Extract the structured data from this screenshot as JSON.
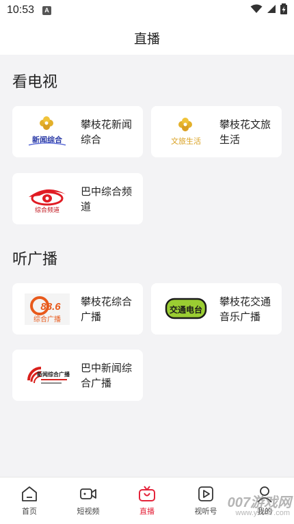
{
  "status_bar": {
    "time": "10:53",
    "indicator": "A",
    "icons": [
      "wifi-icon",
      "signal-icon",
      "battery-charging-icon"
    ]
  },
  "header": {
    "title": "直播"
  },
  "tv_section": {
    "title": "看电视",
    "channels": [
      {
        "name": "攀枝花新闻综合",
        "logo_text": "新闻综合",
        "logo_icon": "flower-emblem-icon"
      },
      {
        "name": "攀枝花文旅生活",
        "logo_text": "文旅生活",
        "logo_icon": "flower-emblem-icon"
      },
      {
        "name": "巴中综合频道",
        "logo_text": "综合频道",
        "logo_icon": "red-eye-logo-icon"
      }
    ]
  },
  "radio_section": {
    "title": "听广播",
    "channels": [
      {
        "name": "攀枝花综合广播",
        "logo_text": "综合广播",
        "logo_number": "88.6",
        "logo_icon": "radio-88-logo-icon"
      },
      {
        "name": "攀枝花交通音乐广播",
        "logo_text": "交通电台",
        "logo_icon": "traffic-radio-logo-icon"
      },
      {
        "name": "巴中新闻综合广播",
        "logo_text": "新闻综合广播",
        "logo_icon": "bazhong-radio-logo-icon"
      }
    ]
  },
  "bottom_nav": {
    "items": [
      {
        "label": "首页",
        "icon": "home-icon",
        "active": false
      },
      {
        "label": "短视频",
        "icon": "video-camera-icon",
        "active": false
      },
      {
        "label": "直播",
        "icon": "live-tv-icon",
        "active": true
      },
      {
        "label": "视听号",
        "icon": "play-icon",
        "active": false
      },
      {
        "label": "我的",
        "icon": "user-icon",
        "active": false
      }
    ]
  },
  "watermark": {
    "text": "007游戏网",
    "url": "www.yx007.com"
  },
  "colors": {
    "accent": "#e4233a",
    "background": "#f3f3f5",
    "card": "#ffffff"
  }
}
